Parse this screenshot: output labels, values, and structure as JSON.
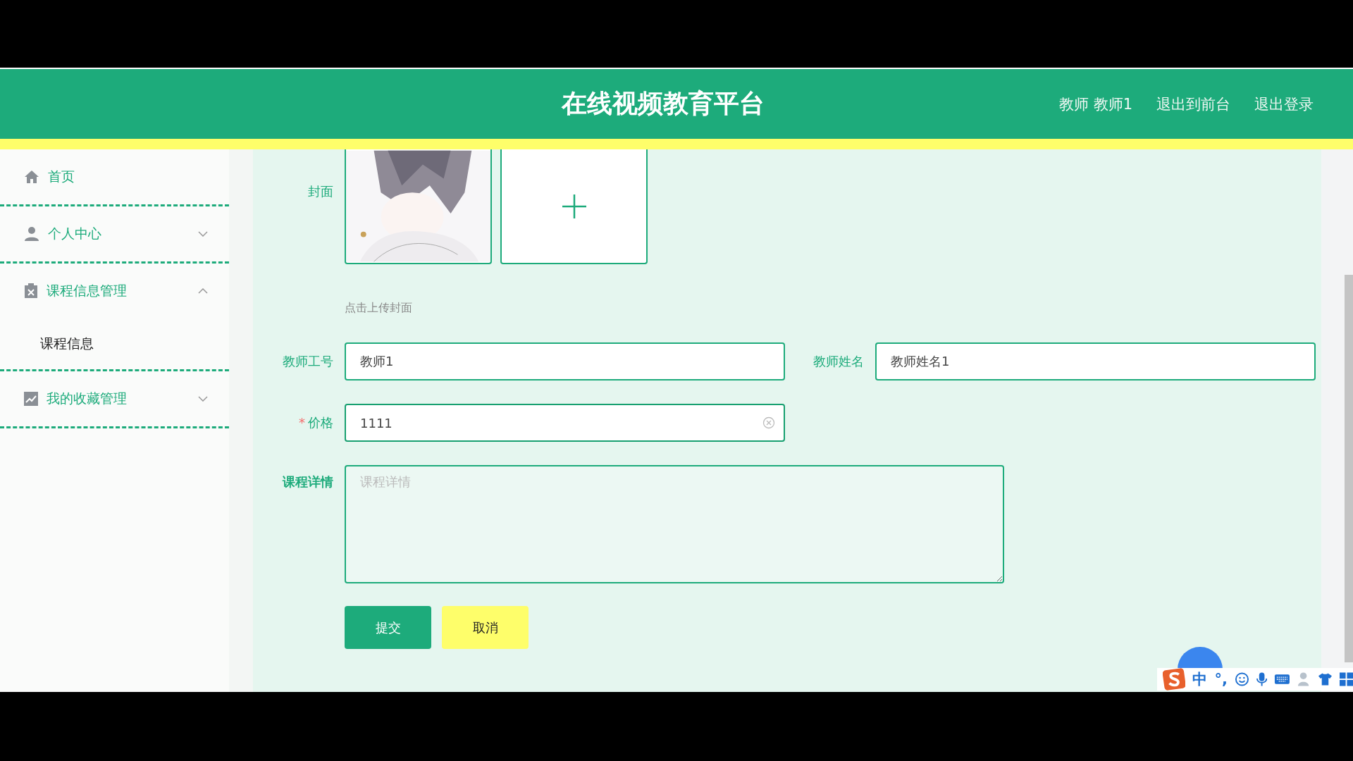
{
  "header": {
    "title": "在线视频教育平台",
    "user": "教师 教师1",
    "links": [
      "退出到前台",
      "退出登录"
    ]
  },
  "sidebar": {
    "items": [
      {
        "kind": "home",
        "label": "首页"
      },
      {
        "kind": "person",
        "label": "个人中心",
        "expanded": false
      },
      {
        "kind": "clipboard",
        "label": "课程信息管理",
        "expanded": true,
        "children": [
          {
            "label": "课程信息"
          }
        ]
      },
      {
        "kind": "chart",
        "label": "我的收藏管理",
        "expanded": false
      }
    ]
  },
  "form": {
    "cover": {
      "label": "封面",
      "hint": "点击上传封面"
    },
    "rows": [
      [
        {
          "label": "教师工号",
          "value": "教师1",
          "focused": false
        },
        {
          "label": "教师姓名",
          "value": "教师姓名1",
          "focused": false
        }
      ],
      [
        {
          "label": "价格",
          "value": "1111",
          "mark": "*",
          "focused": true
        }
      ]
    ],
    "details": {
      "label": "课程详情",
      "placeholder": "课程详情"
    },
    "buttons": [
      {
        "kind": "primary",
        "label": "提交"
      },
      {
        "kind": "cancel",
        "label": "取消"
      }
    ]
  },
  "ime": {
    "items": [
      "中",
      "°,"
    ]
  }
}
